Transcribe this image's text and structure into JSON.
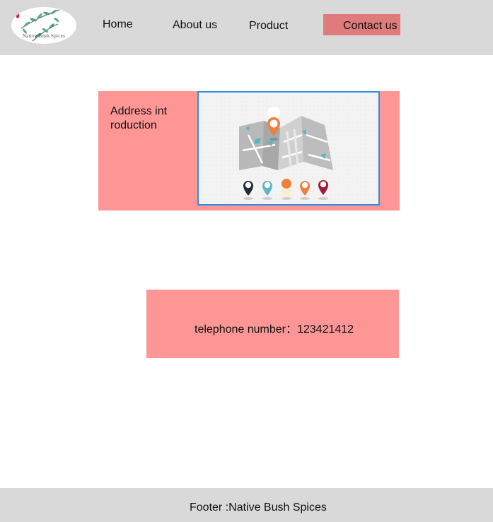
{
  "brand": {
    "logo_text": "Native Bush Spices"
  },
  "nav": {
    "items": [
      {
        "label": "Home"
      },
      {
        "label": "About us"
      },
      {
        "label": "Product"
      },
      {
        "label": "Contact us"
      }
    ]
  },
  "address": {
    "text": "Address introduction"
  },
  "contact": {
    "telephone_text": "telephone number：123421412"
  },
  "footer": {
    "text": "Footer :Native Bush Spices"
  },
  "colors": {
    "header_bg": "#d9d9d9",
    "card_bg": "#ff9696",
    "contact_button_bg": "#e07b7b",
    "map_border": "#2f8fe6"
  },
  "icons": [
    "leaf-branch-logo",
    "map-icon",
    "location-pin-icon"
  ]
}
